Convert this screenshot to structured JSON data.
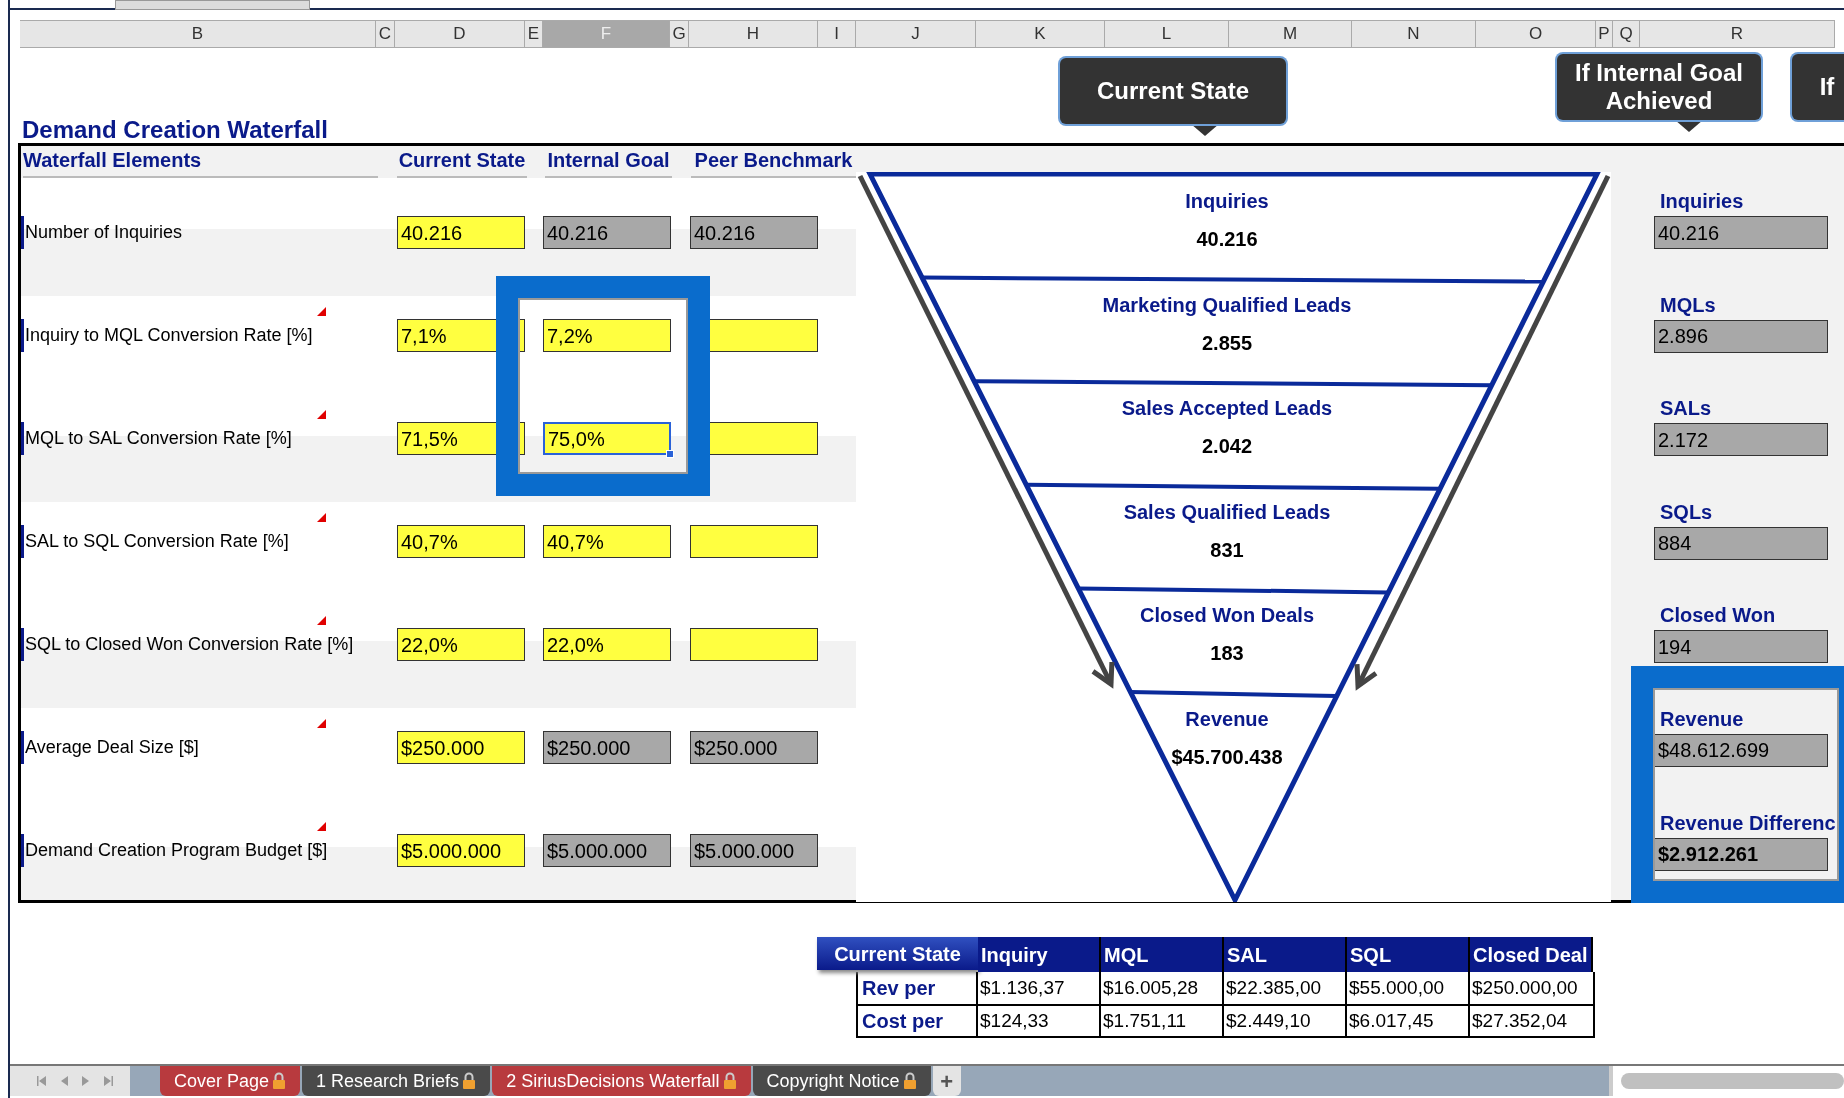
{
  "columns": [
    {
      "label": "B",
      "selected": false
    },
    {
      "label": "C",
      "selected": false
    },
    {
      "label": "D",
      "selected": false
    },
    {
      "label": "E",
      "selected": false
    },
    {
      "label": "F",
      "selected": true
    },
    {
      "label": "G",
      "selected": false
    },
    {
      "label": "H",
      "selected": false
    },
    {
      "label": "I",
      "selected": false
    },
    {
      "label": "J",
      "selected": false
    },
    {
      "label": "K",
      "selected": false
    },
    {
      "label": "L",
      "selected": false
    },
    {
      "label": "M",
      "selected": false
    },
    {
      "label": "N",
      "selected": false
    },
    {
      "label": "O",
      "selected": false
    },
    {
      "label": "P",
      "selected": false
    },
    {
      "label": "Q",
      "selected": false
    },
    {
      "label": "R",
      "selected": false
    }
  ],
  "callouts": [
    "Current State",
    "If Internal Goal Achieved",
    "If"
  ],
  "title": "Demand Creation Waterfall",
  "table": {
    "headers": [
      "Waterfall Elements",
      "Current State",
      "Internal Goal",
      "Peer Benchmark"
    ],
    "rows": [
      {
        "label": "Number of Inquiries",
        "comment": false,
        "cells": [
          {
            "value": "40.216",
            "kind": "input",
            "selected": false
          },
          {
            "value": "40.216",
            "kind": "calc",
            "selected": false
          },
          {
            "value": "40.216",
            "kind": "calc",
            "selected": false
          }
        ]
      },
      {
        "label": "Inquiry to MQL Conversion Rate [%]",
        "comment": true,
        "cells": [
          {
            "value": "7,1%",
            "kind": "input",
            "selected": false
          },
          {
            "value": "7,2%",
            "kind": "input",
            "selected": false
          },
          {
            "kind": "input",
            "selected": false
          }
        ]
      },
      {
        "label": "MQL to SAL Conversion Rate [%]",
        "comment": true,
        "cells": [
          {
            "value": "71,5%",
            "kind": "input",
            "selected": false
          },
          {
            "value": "75,0%",
            "kind": "input",
            "selected": true
          },
          {
            "kind": "input",
            "selected": false
          }
        ]
      },
      {
        "label": "SAL to SQL Conversion Rate [%]",
        "comment": true,
        "cells": [
          {
            "value": "40,7%",
            "kind": "input",
            "selected": false
          },
          {
            "value": "40,7%",
            "kind": "input",
            "selected": false
          },
          {
            "kind": "input",
            "selected": false
          }
        ]
      },
      {
        "label": "SQL to Closed Won Conversion Rate [%]",
        "comment": true,
        "cells": [
          {
            "value": "22,0%",
            "kind": "input",
            "selected": false
          },
          {
            "value": "22,0%",
            "kind": "input",
            "selected": false
          },
          {
            "kind": "input",
            "selected": false
          }
        ]
      },
      {
        "label": "Average Deal Size [$]",
        "comment": true,
        "cells": [
          {
            "value": "$250.000",
            "kind": "input",
            "selected": false
          },
          {
            "value": "$250.000",
            "kind": "calc",
            "selected": false
          },
          {
            "value": "$250.000",
            "kind": "calc",
            "selected": false
          }
        ]
      },
      {
        "label": "Demand Creation Program Budget [$]",
        "comment": true,
        "cells": [
          {
            "value": "$5.000.000",
            "kind": "input",
            "selected": false
          },
          {
            "value": "$5.000.000",
            "kind": "calc",
            "selected": false
          },
          {
            "value": "$5.000.000",
            "kind": "calc",
            "selected": false
          }
        ]
      }
    ]
  },
  "funnel": {
    "stages": [
      {
        "label": "Inquiries",
        "value": "40.216"
      },
      {
        "label": "Marketing Qualified Leads",
        "value": "2.855"
      },
      {
        "label": "Sales Accepted Leads",
        "value": "2.042"
      },
      {
        "label": "Sales Qualified Leads",
        "value": "831"
      },
      {
        "label": "Closed Won Deals",
        "value": "183"
      },
      {
        "label": "Revenue",
        "value": "$45.700.438"
      }
    ]
  },
  "goal_results": [
    {
      "label": "Inquiries",
      "value": "40.216",
      "bold": false
    },
    {
      "label": "MQLs",
      "value": "2.896",
      "bold": false
    },
    {
      "label": "SALs",
      "value": "2.172",
      "bold": false
    },
    {
      "label": "SQLs",
      "value": "884",
      "bold": false
    },
    {
      "label": "Closed Won",
      "value": "194",
      "bold": false
    },
    {
      "label": "Revenue",
      "value": "$48.612.699",
      "bold": false
    },
    {
      "label": "Revenue Differenc",
      "value": "$2.912.261",
      "bold": true
    }
  ],
  "unit_table": {
    "corner": "Current State",
    "columns": [
      "Inquiry",
      "MQL",
      "SAL",
      "SQL",
      "Closed Deal"
    ],
    "rows": [
      {
        "label": "Rev per",
        "values": [
          "$1.136,37",
          "$16.005,28",
          "$22.385,00",
          "$55.000,00",
          "$250.000,00"
        ]
      },
      {
        "label": "Cost per",
        "values": [
          "$124,33",
          "$1.751,11",
          "$2.449,10",
          "$6.017,45",
          "$27.352,04"
        ]
      }
    ]
  },
  "sheet_tabs": [
    {
      "label": "Cover Page",
      "color": "#b83a3e",
      "locked": true
    },
    {
      "label": "1 Research Briefs",
      "color": "#4a4a4a",
      "locked": true
    },
    {
      "label": "2 SiriusDecisions Waterfall",
      "color": "#b83a3e",
      "locked": true
    },
    {
      "label": "Copyright Notice",
      "color": "#4a4a4a",
      "locked": true
    }
  ],
  "add_tab": "+"
}
